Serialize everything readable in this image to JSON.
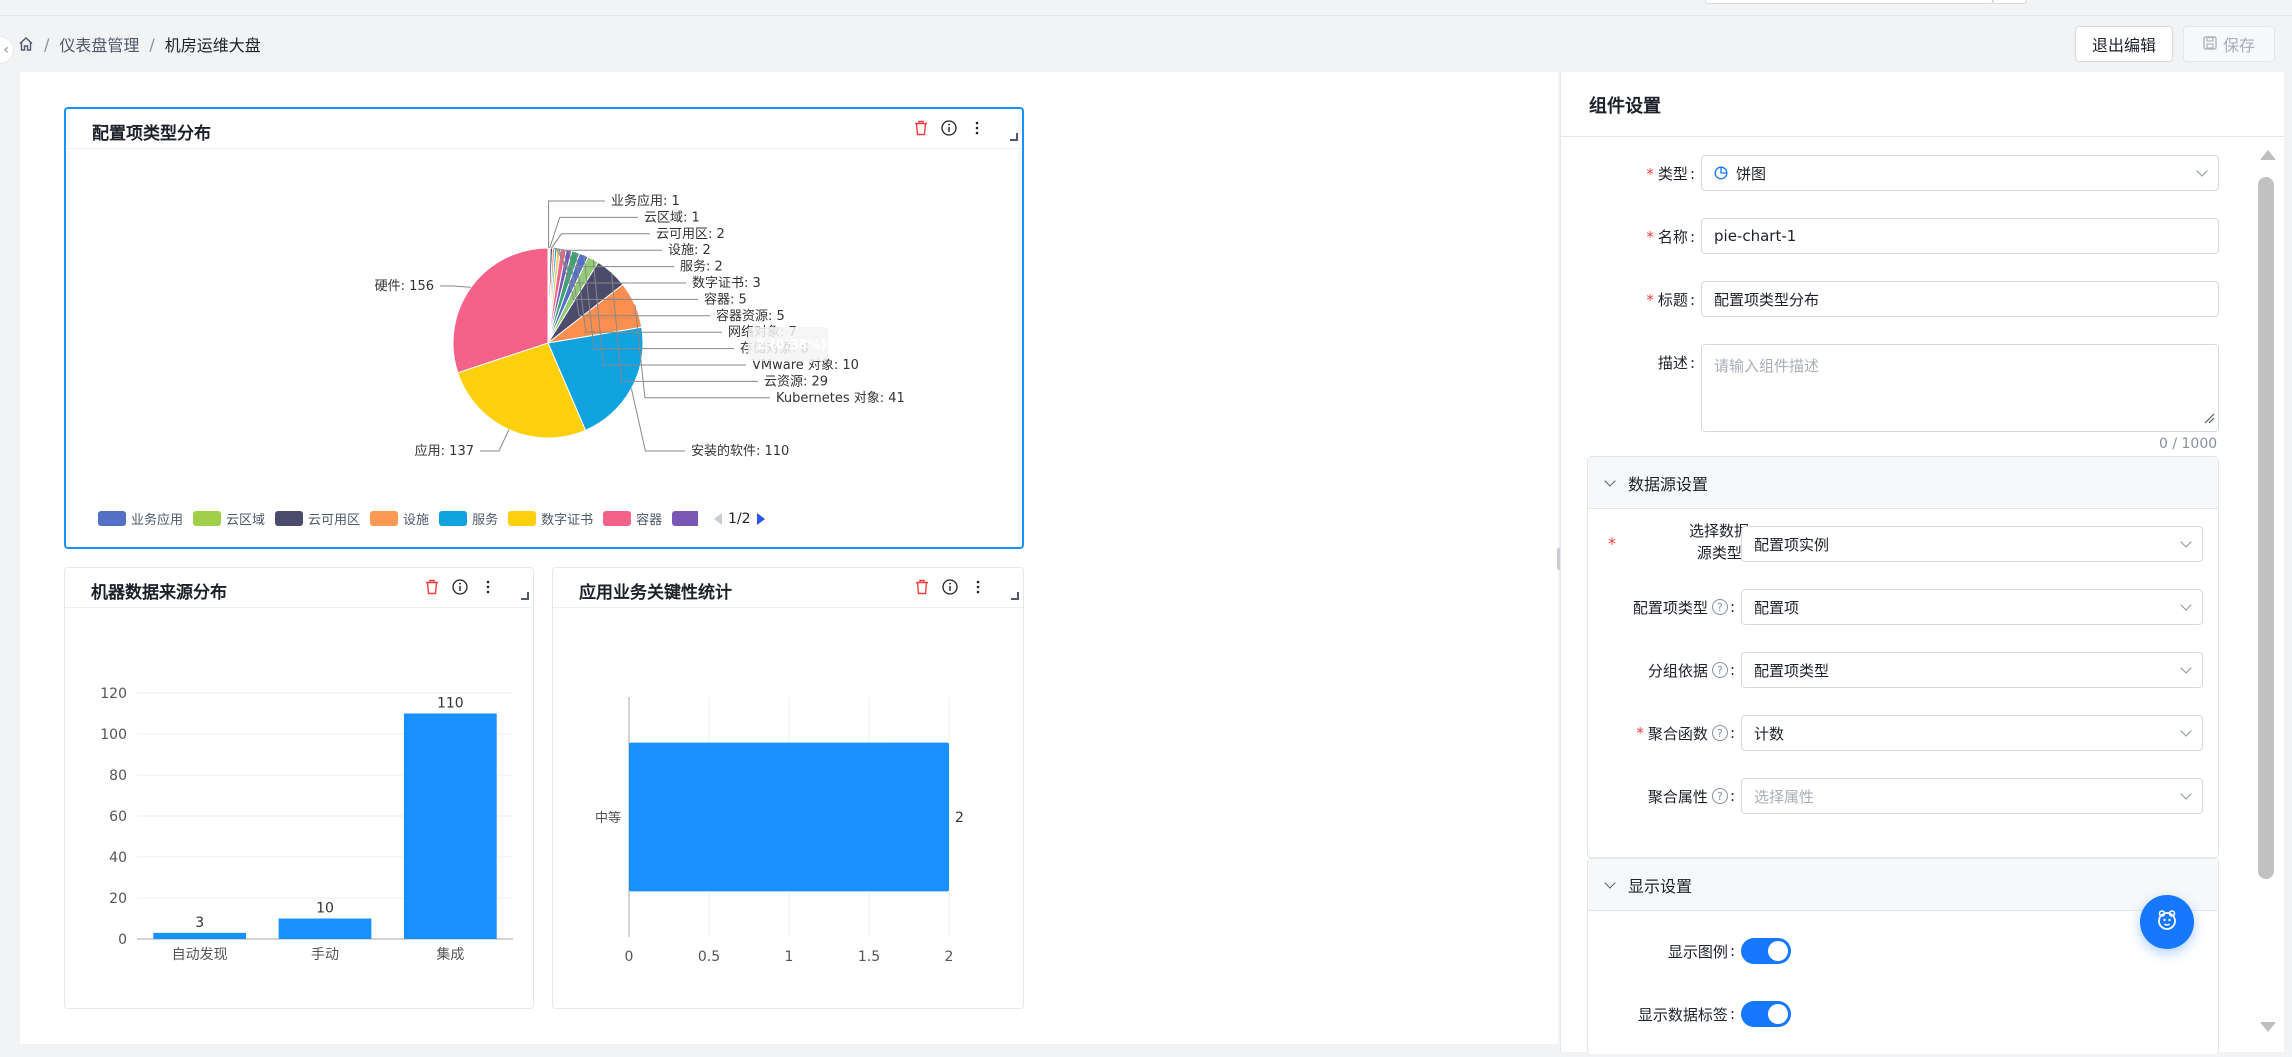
{
  "breadcrumb": {
    "items": [
      "仪表盘管理",
      "机房运维大盘"
    ]
  },
  "header": {
    "exit_label": "退出编辑",
    "save_label": "保存"
  },
  "cards": {
    "pie": {
      "title": "配置项类型分布",
      "tooltip": "2 (0.38%)",
      "legend_page": "1/2"
    },
    "bar_source": {
      "title": "机器数据来源分布"
    },
    "bar_app": {
      "title": "应用业务关键性统计"
    }
  },
  "chart_data": [
    {
      "type": "pie",
      "title": "配置项类型分布",
      "labels": [
        "业务应用",
        "云区域",
        "云可用区",
        "设施",
        "服务",
        "数字证书",
        "容器",
        "容器资源",
        "网络对象",
        "存储对象",
        "VMware 对象",
        "云资源",
        "Kubernetes 对象",
        "安装的软件",
        "应用",
        "硬件"
      ],
      "values": [
        1,
        1,
        2,
        2,
        2,
        3,
        5,
        5,
        7,
        8,
        10,
        29,
        41,
        110,
        137,
        156
      ],
      "label_texts": [
        "业务应用: 1",
        "云区域: 1",
        "云可用区: 2",
        "设施: 2",
        "服务: 2",
        "数字证书: 3",
        "容器: 5",
        "容器资源: 5",
        "网络对象: 7",
        "存储对象: 8",
        "VMware 对象: 10",
        "云资源: 29",
        "Kubernetes 对象: 41",
        "安装的软件: 110",
        "应用: 137",
        "硬件: 156"
      ],
      "colors": [
        "#5470c6",
        "#91cc75",
        "#3e3e65",
        "#fc8452",
        "#0ea5e9",
        "#fac858",
        "#ee6689",
        "#7b57b5",
        "#3ba272",
        "#5470c6",
        "#91cc75",
        "#4b4b6b",
        "#fc8f4f",
        "#10a3e0",
        "#fcd00d",
        "#f4628a"
      ],
      "legend_visible": [
        "业务应用",
        "云区域",
        "云可用区",
        "设施",
        "服务",
        "数字证书",
        "容器",
        "容器资源",
        "网络对象",
        "存"
      ],
      "legend_colors": [
        "#5470c6",
        "#a0d04a",
        "#4b4b6b",
        "#fc9a52",
        "#10a3e0",
        "#fcd00d",
        "#f4628a",
        "#7b57b5",
        "#3fbf8f",
        "#5470c6"
      ]
    },
    {
      "type": "bar",
      "title": "机器数据来源分布",
      "categories": [
        "自动发现",
        "手动",
        "集成"
      ],
      "values": [
        3,
        10,
        110
      ],
      "ylim": [
        0,
        120
      ],
      "yticks": [
        0,
        20,
        40,
        60,
        80,
        100,
        120
      ],
      "color": "#1890ff",
      "grid": true
    },
    {
      "type": "bar",
      "orientation": "horizontal",
      "title": "应用业务关键性统计",
      "categories": [
        "中等"
      ],
      "values": [
        2
      ],
      "xlim": [
        0,
        2
      ],
      "xticks": [
        "0",
        "0.5",
        "1",
        "1.5",
        "2"
      ],
      "color": "#1890ff"
    }
  ],
  "side": {
    "title": "组件设置",
    "type_label": "类型",
    "type_value": "饼图",
    "name_label": "名称",
    "name_value": "pie-chart-1",
    "title_label": "标题",
    "title_value": "配置项类型分布",
    "desc_label": "描述",
    "desc_placeholder": "请输入组件描述",
    "desc_counter": "0 / 1000",
    "datasource": {
      "header": "数据源设置",
      "source_type_label_1": "选择数据",
      "source_type_label_2": "源类型",
      "source_type_value": "配置项实例",
      "ci_type_label": "配置项类型",
      "ci_type_value": "配置项",
      "group_label": "分组依据",
      "group_value": "配置项类型",
      "agg_label": "聚合函数",
      "agg_value": "计数",
      "agg_attr_label": "聚合属性",
      "agg_attr_placeholder": "选择属性"
    },
    "display": {
      "header": "显示设置",
      "legend_label": "显示图例",
      "legend_on": true,
      "data_label_label": "显示数据标签",
      "data_label_on": true
    }
  },
  "colors": {
    "accent": "#1677ff",
    "bar": "#1890ff",
    "danger": "#f53f3f"
  }
}
